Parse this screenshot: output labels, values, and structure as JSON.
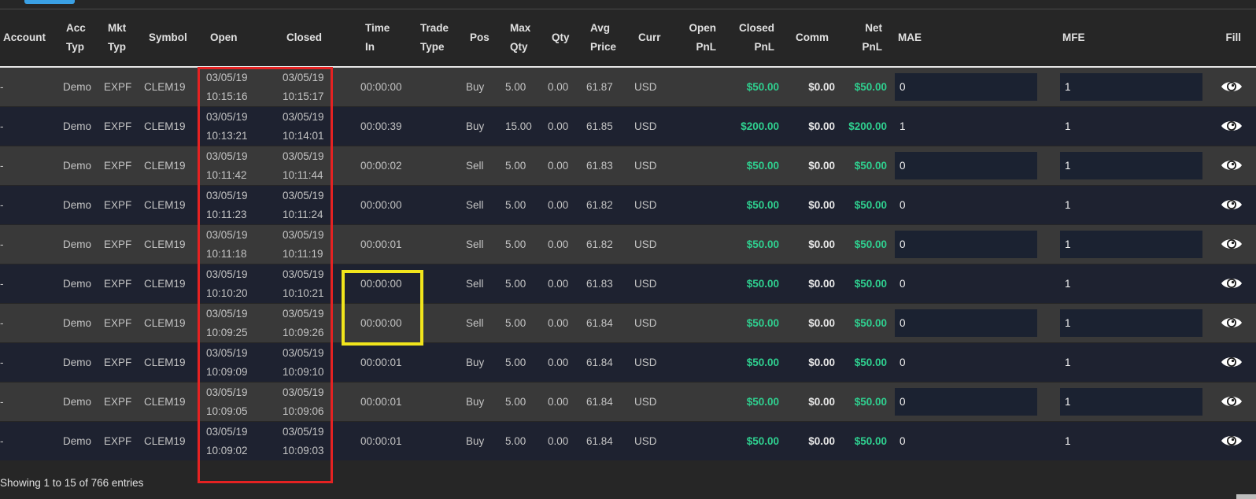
{
  "table": {
    "columns": [
      {
        "key": "account",
        "lines": [
          "Account"
        ]
      },
      {
        "key": "acc_typ",
        "lines": [
          "Acc",
          "Typ"
        ]
      },
      {
        "key": "mkt_typ",
        "lines": [
          "Mkt",
          "Typ"
        ]
      },
      {
        "key": "symbol",
        "lines": [
          "Symbol"
        ]
      },
      {
        "key": "open",
        "lines": [
          "Open"
        ]
      },
      {
        "key": "closed",
        "lines": [
          "Closed"
        ]
      },
      {
        "key": "time_in",
        "lines": [
          "Time",
          "In"
        ]
      },
      {
        "key": "trade_type",
        "lines": [
          "Trade",
          "Type"
        ]
      },
      {
        "key": "pos",
        "lines": [
          "Pos"
        ]
      },
      {
        "key": "max_qty",
        "lines": [
          "Max",
          "Qty"
        ]
      },
      {
        "key": "qty",
        "lines": [
          "Qty"
        ]
      },
      {
        "key": "avg_price",
        "lines": [
          "Avg",
          "Price"
        ]
      },
      {
        "key": "curr",
        "lines": [
          "Curr"
        ]
      },
      {
        "key": "open_pnl",
        "lines": [
          "Open",
          "PnL"
        ]
      },
      {
        "key": "closed_pnl",
        "lines": [
          "Closed",
          "PnL"
        ]
      },
      {
        "key": "comm",
        "lines": [
          "Comm"
        ]
      },
      {
        "key": "net_pnl",
        "lines": [
          "Net",
          "PnL"
        ]
      },
      {
        "key": "mae",
        "lines": [
          "MAE"
        ]
      },
      {
        "key": "mfe",
        "lines": [
          "MFE"
        ]
      },
      {
        "key": "fill",
        "lines": [
          "Fill"
        ]
      }
    ],
    "rows": [
      {
        "account": "-",
        "acc_typ": "Demo",
        "mkt_typ": "EXPF",
        "symbol": "CLEM19",
        "open_date": "03/05/19",
        "open_time": "10:15:16",
        "closed_date": "03/05/19",
        "closed_time": "10:15:17",
        "time_in": "00:00:00",
        "trade_type": "",
        "pos": "Buy",
        "max_qty": "5.00",
        "qty": "0.00",
        "avg_price": "61.87",
        "curr": "USD",
        "open_pnl": "",
        "closed_pnl": "$50.00",
        "comm": "$0.00",
        "net_pnl": "$50.00",
        "mae": "0",
        "mfe": "1",
        "mae_box": true,
        "mfe_box": true
      },
      {
        "account": "-",
        "acc_typ": "Demo",
        "mkt_typ": "EXPF",
        "symbol": "CLEM19",
        "open_date": "03/05/19",
        "open_time": "10:13:21",
        "closed_date": "03/05/19",
        "closed_time": "10:14:01",
        "time_in": "00:00:39",
        "trade_type": "",
        "pos": "Buy",
        "max_qty": "15.00",
        "qty": "0.00",
        "avg_price": "61.85",
        "curr": "USD",
        "open_pnl": "",
        "closed_pnl": "$200.00",
        "comm": "$0.00",
        "net_pnl": "$200.00",
        "mae": "1",
        "mfe": "1",
        "mae_box": false,
        "mfe_box": false
      },
      {
        "account": "-",
        "acc_typ": "Demo",
        "mkt_typ": "EXPF",
        "symbol": "CLEM19",
        "open_date": "03/05/19",
        "open_time": "10:11:42",
        "closed_date": "03/05/19",
        "closed_time": "10:11:44",
        "time_in": "00:00:02",
        "trade_type": "",
        "pos": "Sell",
        "max_qty": "5.00",
        "qty": "0.00",
        "avg_price": "61.83",
        "curr": "USD",
        "open_pnl": "",
        "closed_pnl": "$50.00",
        "comm": "$0.00",
        "net_pnl": "$50.00",
        "mae": "0",
        "mfe": "1",
        "mae_box": true,
        "mfe_box": true
      },
      {
        "account": "-",
        "acc_typ": "Demo",
        "mkt_typ": "EXPF",
        "symbol": "CLEM19",
        "open_date": "03/05/19",
        "open_time": "10:11:23",
        "closed_date": "03/05/19",
        "closed_time": "10:11:24",
        "time_in": "00:00:00",
        "trade_type": "",
        "pos": "Sell",
        "max_qty": "5.00",
        "qty": "0.00",
        "avg_price": "61.82",
        "curr": "USD",
        "open_pnl": "",
        "closed_pnl": "$50.00",
        "comm": "$0.00",
        "net_pnl": "$50.00",
        "mae": "0",
        "mfe": "1",
        "mae_box": false,
        "mfe_box": false
      },
      {
        "account": "-",
        "acc_typ": "Demo",
        "mkt_typ": "EXPF",
        "symbol": "CLEM19",
        "open_date": "03/05/19",
        "open_time": "10:11:18",
        "closed_date": "03/05/19",
        "closed_time": "10:11:19",
        "time_in": "00:00:01",
        "trade_type": "",
        "pos": "Sell",
        "max_qty": "5.00",
        "qty": "0.00",
        "avg_price": "61.82",
        "curr": "USD",
        "open_pnl": "",
        "closed_pnl": "$50.00",
        "comm": "$0.00",
        "net_pnl": "$50.00",
        "mae": "0",
        "mfe": "1",
        "mae_box": true,
        "mfe_box": true
      },
      {
        "account": "-",
        "acc_typ": "Demo",
        "mkt_typ": "EXPF",
        "symbol": "CLEM19",
        "open_date": "03/05/19",
        "open_time": "10:10:20",
        "closed_date": "03/05/19",
        "closed_time": "10:10:21",
        "time_in": "00:00:00",
        "trade_type": "",
        "pos": "Sell",
        "max_qty": "5.00",
        "qty": "0.00",
        "avg_price": "61.83",
        "curr": "USD",
        "open_pnl": "",
        "closed_pnl": "$50.00",
        "comm": "$0.00",
        "net_pnl": "$50.00",
        "mae": "0",
        "mfe": "1",
        "mae_box": false,
        "mfe_box": false
      },
      {
        "account": "-",
        "acc_typ": "Demo",
        "mkt_typ": "EXPF",
        "symbol": "CLEM19",
        "open_date": "03/05/19",
        "open_time": "10:09:25",
        "closed_date": "03/05/19",
        "closed_time": "10:09:26",
        "time_in": "00:00:00",
        "trade_type": "",
        "pos": "Sell",
        "max_qty": "5.00",
        "qty": "0.00",
        "avg_price": "61.84",
        "curr": "USD",
        "open_pnl": "",
        "closed_pnl": "$50.00",
        "comm": "$0.00",
        "net_pnl": "$50.00",
        "mae": "0",
        "mfe": "1",
        "mae_box": true,
        "mfe_box": true
      },
      {
        "account": "-",
        "acc_typ": "Demo",
        "mkt_typ": "EXPF",
        "symbol": "CLEM19",
        "open_date": "03/05/19",
        "open_time": "10:09:09",
        "closed_date": "03/05/19",
        "closed_time": "10:09:10",
        "time_in": "00:00:01",
        "trade_type": "",
        "pos": "Buy",
        "max_qty": "5.00",
        "qty": "0.00",
        "avg_price": "61.84",
        "curr": "USD",
        "open_pnl": "",
        "closed_pnl": "$50.00",
        "comm": "$0.00",
        "net_pnl": "$50.00",
        "mae": "0",
        "mfe": "1",
        "mae_box": false,
        "mfe_box": false
      },
      {
        "account": "-",
        "acc_typ": "Demo",
        "mkt_typ": "EXPF",
        "symbol": "CLEM19",
        "open_date": "03/05/19",
        "open_time": "10:09:05",
        "closed_date": "03/05/19",
        "closed_time": "10:09:06",
        "time_in": "00:00:01",
        "trade_type": "",
        "pos": "Buy",
        "max_qty": "5.00",
        "qty": "0.00",
        "avg_price": "61.84",
        "curr": "USD",
        "open_pnl": "",
        "closed_pnl": "$50.00",
        "comm": "$0.00",
        "net_pnl": "$50.00",
        "mae": "0",
        "mfe": "1",
        "mae_box": true,
        "mfe_box": true
      },
      {
        "account": "-",
        "acc_typ": "Demo",
        "mkt_typ": "EXPF",
        "symbol": "CLEM19",
        "open_date": "03/05/19",
        "open_time": "10:09:02",
        "closed_date": "03/05/19",
        "closed_time": "10:09:03",
        "time_in": "00:00:01",
        "trade_type": "",
        "pos": "Buy",
        "max_qty": "5.00",
        "qty": "0.00",
        "avg_price": "61.84",
        "curr": "USD",
        "open_pnl": "",
        "closed_pnl": "$50.00",
        "comm": "$0.00",
        "net_pnl": "$50.00",
        "mae": "0",
        "mfe": "1",
        "mae_box": false,
        "mfe_box": false
      }
    ]
  },
  "footer": {
    "info": "Showing 1 to 15 of 766 entries"
  },
  "colors": {
    "pnl_positive": "#2fcf8f",
    "highlight_open_closed": "#e52222",
    "highlight_time_in": "#f1e51c",
    "accent_tab": "#3aa0e4"
  },
  "icons": {
    "fill": "eye-icon"
  }
}
